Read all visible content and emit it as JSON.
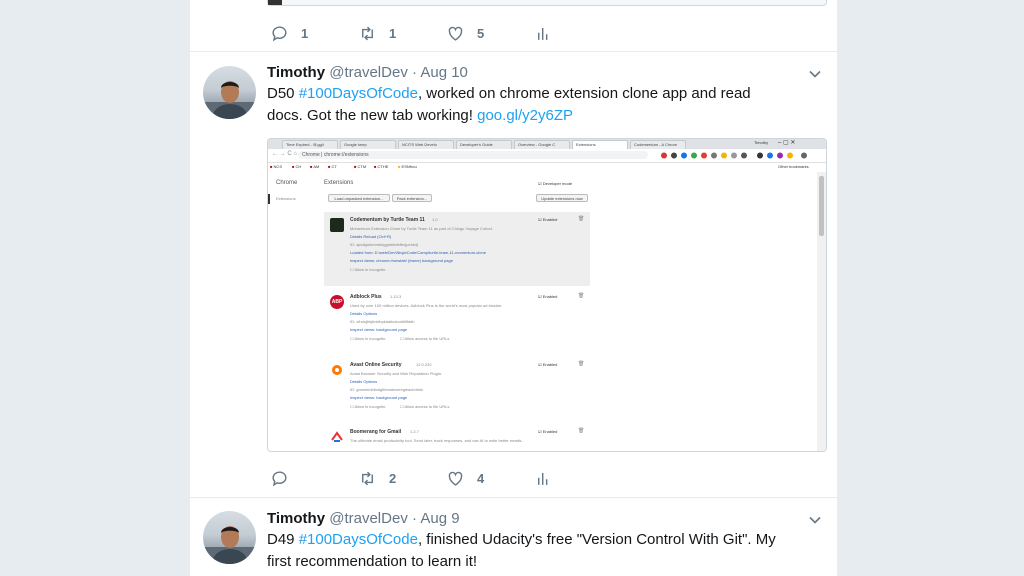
{
  "prev_tweet": {
    "replies": "1",
    "retweets": "1",
    "likes": "5"
  },
  "tweet1": {
    "name": "Timothy",
    "handle": "@travelDev",
    "date": "Aug 10",
    "text_before": "D50 ",
    "hashtag": "#100DaysOfCode",
    "text_after": ", worked on chrome extension clone app and read docs. Got the new tab working! ",
    "link": "goo.gl/y2y6ZP",
    "replies": "",
    "retweets": "2",
    "likes": "4",
    "screenshot": {
      "tabs": [
        "Time Expired - \\$ gg/i",
        "Google keep",
        "NCITS Web Develo",
        "Developer's Guide",
        "Overview - Google C",
        "Extensions",
        "Codementum - A Chrom"
      ],
      "tab_user": "Timothy",
      "address": "Chrome | chrome://extensions",
      "bookmarks": [
        "NCS",
        "CH",
        "AM",
        "CT",
        "CTM",
        "CTHE",
        "ESNfrou"
      ],
      "other_bookmarks": "Other bookmarks",
      "sidebar_title": "Chrome",
      "sidebar_item": "Extensions",
      "page_title": "Extensions",
      "developer_mode": "Developer mode",
      "btn_load": "Load unpacked extension...",
      "btn_pack": "Pack extension...",
      "btn_update": "Update extensions now",
      "enabled": "Enabled",
      "extensions": [
        {
          "name": "Codementum by Turtle Team 11",
          "version": "1.0",
          "desc": "Momentum Extension Clone by Turtle Team 11 as part of Chingu Voyage Cohort.",
          "links": "Details    Reload (Ctrl+R)",
          "id": "ID: ajodigmkmmbdggnbkbfefbnjpehkdj",
          "loaded": "Loaded from:  D:\\web\\Dev\\Ninja\\Code\\Camp\\turtle-team-11-momentum-clone",
          "inspect": "Inspect views:  chrome://newtab/ (frame)  background page",
          "allow1": "Allow in incognito",
          "allow2": ""
        },
        {
          "name": "Adblock Plus",
          "version": "1.13.3",
          "desc": "Used by over 100 million devices. Adblock Plus is the world's most popular ad blocker.",
          "links": "Details    Options",
          "id": "ID: cfhdojbkjhnklbpkdaibdccddilifddb",
          "loaded": "",
          "inspect": "Inspect views:  background page",
          "allow1": "Allow in incognito",
          "allow2": "Allow access to file URLs"
        },
        {
          "name": "Avast Online Security",
          "version": "12.0.232",
          "desc": "Avast Browser Security and Web Reputation Plugin.",
          "links": "Details    Options",
          "id": "ID: gomekmidlodglbbmalcneegieacbdmki",
          "loaded": "",
          "inspect": "Inspect views:  background page",
          "allow1": "Allow in incognito",
          "allow2": "Allow access to file URLs"
        },
        {
          "name": "Boomerang for Gmail",
          "version": "1.2.7",
          "desc": "The ultimate email productivity tool. Send later, track responses, and use AI to write better emails.",
          "links": "",
          "id": "",
          "loaded": "",
          "inspect": "",
          "allow1": "",
          "allow2": ""
        }
      ]
    }
  },
  "tweet2": {
    "name": "Timothy",
    "handle": "@travelDev",
    "date": "Aug 9",
    "text_before": "D49 ",
    "hashtag": "#100DaysOfCode",
    "text_after": ", finished Udacity's free \"Version Control With Git\". My first recommendation to learn it!"
  },
  "colors": {
    "accent": "#1da1f2",
    "secondary": "#657786",
    "page_bg": "#e6ecf0"
  }
}
